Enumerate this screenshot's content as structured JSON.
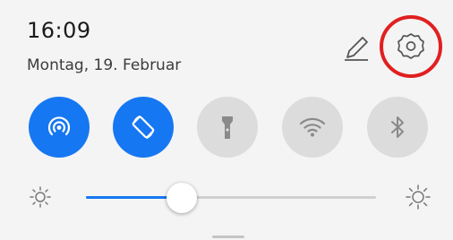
{
  "status": {
    "time": "16:09",
    "date": "Montag, 19. Februar"
  },
  "header_actions": [
    {
      "name": "edit",
      "icon": "pencil-icon"
    },
    {
      "name": "settings",
      "icon": "gear-icon",
      "highlight_color": "#e02020"
    }
  ],
  "quick_toggles": [
    {
      "name": "hotspot",
      "icon": "hotspot-icon",
      "state": "on"
    },
    {
      "name": "auto-rotate",
      "icon": "rotate-icon",
      "state": "on"
    },
    {
      "name": "flashlight",
      "icon": "flashlight-icon",
      "state": "off"
    },
    {
      "name": "wifi",
      "icon": "wifi-icon",
      "state": "off"
    },
    {
      "name": "bluetooth",
      "icon": "bluetooth-icon",
      "state": "off"
    }
  ],
  "brightness": {
    "level": 0.33,
    "min_icon": "sun-dim-icon",
    "max_icon": "sun-bright-icon"
  },
  "colors": {
    "accent": "#1677f2",
    "toggle_off": "#dcdcdc",
    "highlight": "#e02020"
  }
}
